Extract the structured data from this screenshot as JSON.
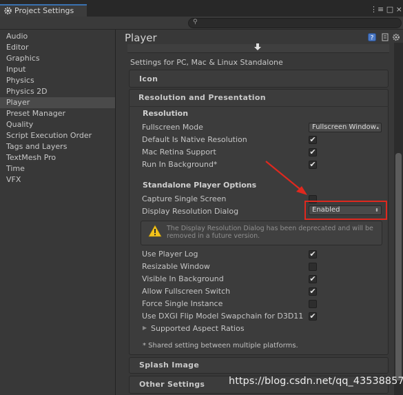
{
  "window": {
    "tab_title": "Project Settings",
    "search_placeholder": ""
  },
  "sidebar": {
    "items": [
      {
        "label": "Audio"
      },
      {
        "label": "Editor"
      },
      {
        "label": "Graphics"
      },
      {
        "label": "Input"
      },
      {
        "label": "Physics"
      },
      {
        "label": "Physics 2D"
      },
      {
        "label": "Player",
        "selected": true
      },
      {
        "label": "Preset Manager"
      },
      {
        "label": "Quality"
      },
      {
        "label": "Script Execution Order"
      },
      {
        "label": "Tags and Layers"
      },
      {
        "label": "TextMesh Pro"
      },
      {
        "label": "Time"
      },
      {
        "label": "VFX"
      }
    ]
  },
  "main": {
    "title": "Player",
    "platform_label": "Settings for PC, Mac & Linux Standalone",
    "sections": {
      "icon": "Icon",
      "resolution_presentation": "Resolution and Presentation",
      "splash": "Splash Image",
      "other": "Other Settings"
    },
    "resolution": {
      "heading": "Resolution",
      "fullscreen_mode_label": "Fullscreen Mode",
      "fullscreen_mode_value": "Fullscreen Window",
      "default_native_label": "Default Is Native Resolution",
      "default_native_checked": true,
      "mac_retina_label": "Mac Retina Support",
      "mac_retina_checked": true,
      "run_background_label": "Run In Background*",
      "run_background_checked": true
    },
    "standalone": {
      "heading": "Standalone Player Options",
      "capture_single_screen_label": "Capture Single Screen",
      "capture_single_screen_checked": false,
      "display_dialog_label": "Display Resolution Dialog",
      "display_dialog_value": "Enabled",
      "warning_text": "The Display Resolution Dialog has been deprecated and will be removed in a future version.",
      "use_player_log_label": "Use Player Log",
      "use_player_log_checked": true,
      "resizable_window_label": "Resizable Window",
      "resizable_window_checked": false,
      "visible_background_label": "Visible In Background",
      "visible_background_checked": true,
      "allow_fullscreen_switch_label": "Allow Fullscreen Switch",
      "allow_fullscreen_switch_checked": true,
      "force_single_instance_label": "Force Single Instance",
      "force_single_instance_checked": false,
      "dxgi_label": "Use DXGI Flip Model Swapchain for D3D11",
      "dxgi_checked": true,
      "supported_aspect_label": "Supported Aspect Ratios",
      "shared_note": "* Shared setting between multiple platforms."
    }
  },
  "watermark": "https://blog.csdn.net/qq_43538857",
  "colors": {
    "annotation_red": "#e0281e",
    "selection_bg": "#4a4a4a"
  },
  "icons": [
    "gear-icon",
    "search-icon",
    "menu-icon",
    "help-icon",
    "settings-icon",
    "download-icon",
    "warning-icon",
    "foldout-arrow-icon"
  ]
}
